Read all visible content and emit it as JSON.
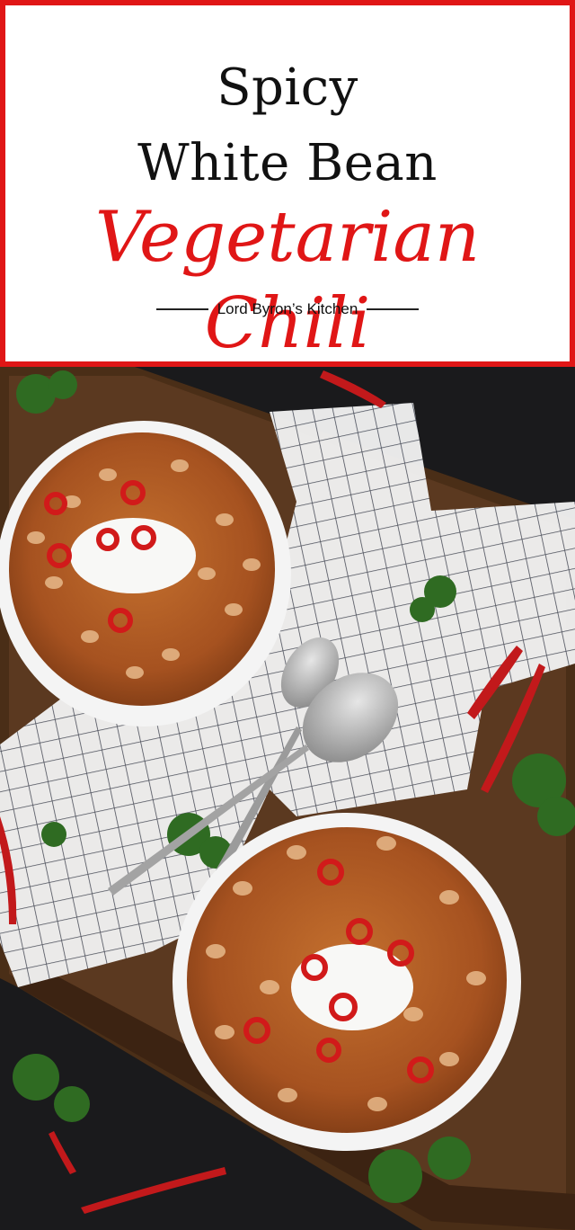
{
  "title": {
    "line1": "Spicy",
    "line2": "White Bean",
    "line3": "Vegetarian Chili",
    "byline": "Lord Byron’s Kitchen"
  },
  "colors": {
    "accent_red": "#e01616",
    "card_bg": "#ffffff",
    "photo_bg": "#1a1a1c"
  },
  "photo": {
    "subject": "two bowls of white bean chili with sour cream and sliced red chilies",
    "icons": [
      "bowl-icon",
      "spoon-icon",
      "chili-pepper-icon",
      "parsley-icon",
      "towel-icon"
    ]
  }
}
